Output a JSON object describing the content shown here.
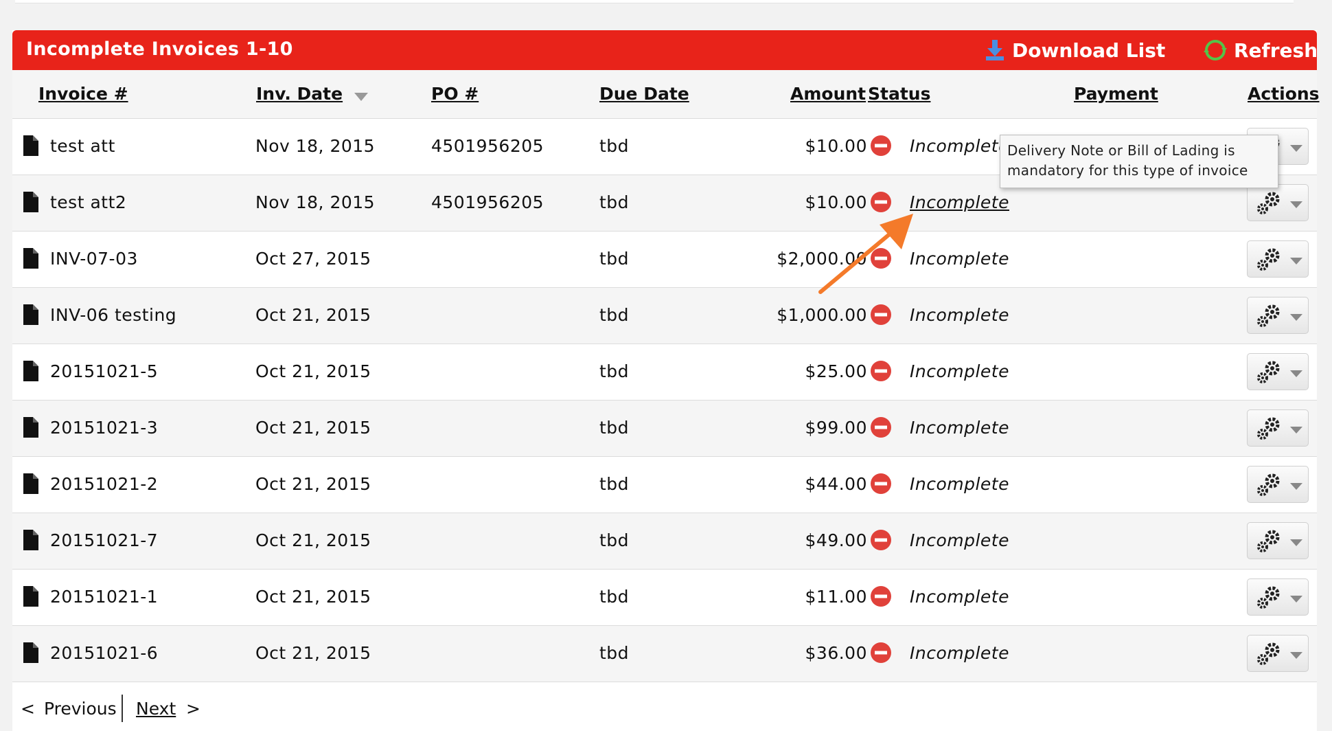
{
  "header": {
    "title": "Incomplete Invoices 1-10",
    "download_label": "Download List",
    "refresh_label": "Refresh"
  },
  "columns": {
    "invoice": "Invoice #",
    "date": "Inv. Date",
    "po": "PO #",
    "due": "Due Date",
    "amount": "Amount",
    "status": "Status",
    "payment": "Payment",
    "actions": "Actions"
  },
  "rows": [
    {
      "invoice": "test att",
      "date": "Nov 18, 2015",
      "po": "4501956205",
      "due": "tbd",
      "amount": "$10.00",
      "status": "Incomplete"
    },
    {
      "invoice": "test att2",
      "date": "Nov 18, 2015",
      "po": "4501956205",
      "due": "tbd",
      "amount": "$10.00",
      "status": "Incomplete"
    },
    {
      "invoice": "INV-07-03",
      "date": "Oct 27, 2015",
      "po": "",
      "due": "tbd",
      "amount": "$2,000.00",
      "status": "Incomplete"
    },
    {
      "invoice": "INV-06 testing",
      "date": "Oct 21, 2015",
      "po": "",
      "due": "tbd",
      "amount": "$1,000.00",
      "status": "Incomplete"
    },
    {
      "invoice": "20151021-5",
      "date": "Oct 21, 2015",
      "po": "",
      "due": "tbd",
      "amount": "$25.00",
      "status": "Incomplete"
    },
    {
      "invoice": "20151021-3",
      "date": "Oct 21, 2015",
      "po": "",
      "due": "tbd",
      "amount": "$99.00",
      "status": "Incomplete"
    },
    {
      "invoice": "20151021-2",
      "date": "Oct 21, 2015",
      "po": "",
      "due": "tbd",
      "amount": "$44.00",
      "status": "Incomplete"
    },
    {
      "invoice": "20151021-7",
      "date": "Oct 21, 2015",
      "po": "",
      "due": "tbd",
      "amount": "$49.00",
      "status": "Incomplete"
    },
    {
      "invoice": "20151021-1",
      "date": "Oct 21, 2015",
      "po": "",
      "due": "tbd",
      "amount": "$11.00",
      "status": "Incomplete"
    },
    {
      "invoice": "20151021-6",
      "date": "Oct 21, 2015",
      "po": "",
      "due": "tbd",
      "amount": "$36.00",
      "status": "Incomplete"
    }
  ],
  "tooltip": {
    "line1": "Delivery Note or Bill of Lading is",
    "line2": "mandatory for this type of invoice"
  },
  "pager": {
    "prev_caret": "<",
    "previous": "Previous",
    "next": "Next",
    "next_caret": ">"
  },
  "icons": {
    "row": "document-icon",
    "status": "stop-icon",
    "actions": "gear-icon",
    "download": "download-icon",
    "refresh": "refresh-icon",
    "annotation": "orange-arrow"
  },
  "colors": {
    "header_bg": "#e8231a",
    "status_icon": "#e0413a",
    "arrow": "#f47a2a"
  }
}
